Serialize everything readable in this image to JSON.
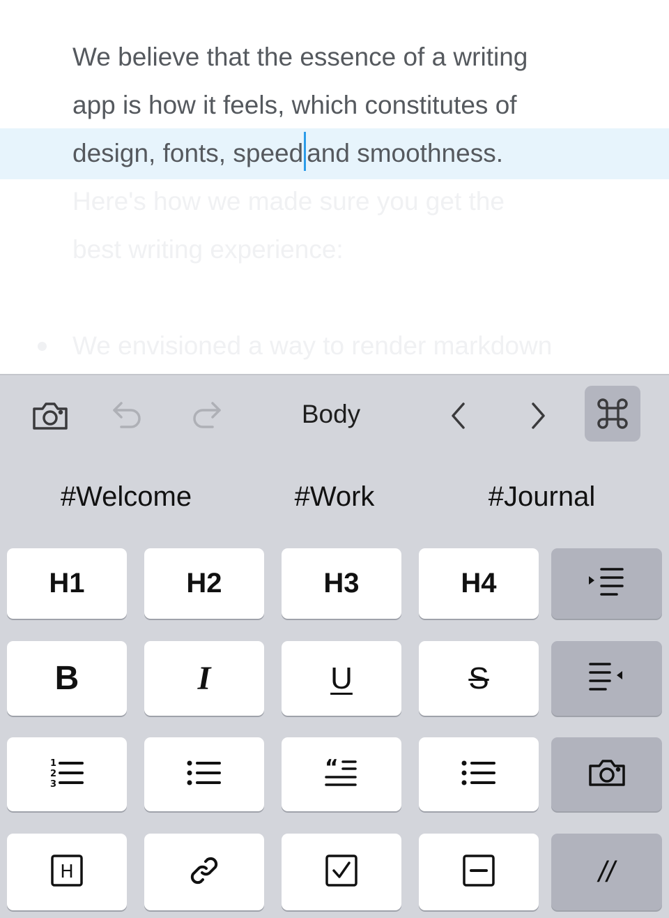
{
  "editor": {
    "line1": "We believe that the essence of a writing",
    "line2": "app is how it feels, which constitutes of",
    "line3_before_cursor": "design, fonts, speed",
    "line3_after_cursor": "and smoothness.",
    "line4": "Here's how we made sure you get the",
    "line5": "best writing experience:",
    "bullet_text": "We envisioned a way to render markdown"
  },
  "toolbar": {
    "camera_icon": "camera-icon",
    "undo_icon": "undo-icon",
    "redo_icon": "redo-icon",
    "style_label": "Body",
    "prev_icon": "chevron-left-icon",
    "next_icon": "chevron-right-icon",
    "command_icon": "command-icon"
  },
  "tags": [
    "#Welcome",
    "#Work",
    "#Journal"
  ],
  "keys": {
    "h1": "H1",
    "h2": "H2",
    "h3": "H3",
    "h4": "H4",
    "bold": "B",
    "italic": "I",
    "underline": "U",
    "strikethrough": "S",
    "comment": "//"
  },
  "colors": {
    "cursor": "#2b9be8",
    "highlight": "#e7f4fc",
    "keyboard_bg": "#d3d5db",
    "key_bg": "#ffffff",
    "key_gray": "#b1b3bd"
  }
}
